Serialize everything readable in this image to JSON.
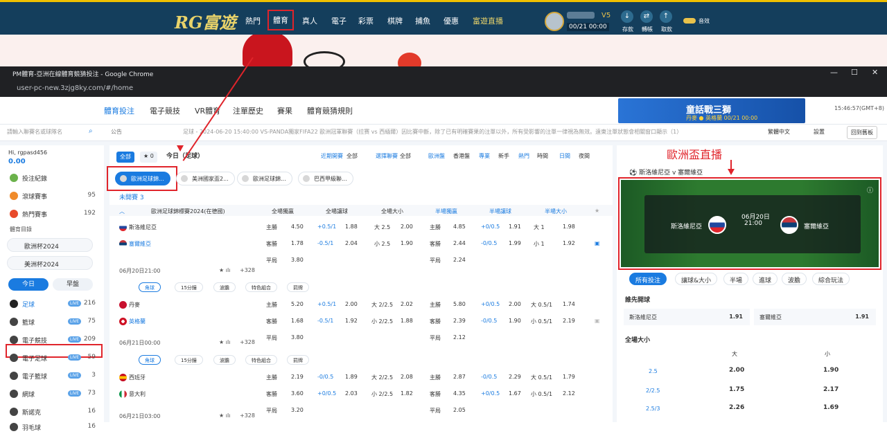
{
  "site": {
    "logo": "RG富遊",
    "nav": [
      "熱門",
      "體育",
      "真人",
      "電子",
      "彩票",
      "棋牌",
      "捕魚",
      "優惠",
      "富遊直播"
    ],
    "vip": "V5",
    "balance": "00/21 00:00",
    "top_icons": [
      "存款",
      "轉帳",
      "取款"
    ],
    "sound": "音效"
  },
  "chrome": {
    "title": "PM體育-亞洲在線體育競猜投注 - Google Chrome",
    "url": "user-pc-new.3zjg8ky.com/#/home",
    "min": "—",
    "max": "☐",
    "close": "✕"
  },
  "subnav": {
    "tabs": [
      "體育投注",
      "電子競技",
      "VR體育",
      "注單歷史",
      "賽果",
      "體育競猜規則"
    ],
    "promo_title": "童話戰三獅",
    "promo_sub": "丹麥 ● 英格蘭 00/21 00:00",
    "time": "15:46:57(GMT+8)"
  },
  "secondbar": {
    "search_placeholder": "請輸入聯賽名或球隊名",
    "notice_label": "公告",
    "marquee": "足球 - 2024-06-20 15:40:00 VS-PANDA獨家FIFA22 歐洲冠軍聯賽（拉赛 vs 西緬爾）因比賽中斷，除了已有明確賽果的注單以外，所有受影響的注單一律視為無效。遠東注單狀態會相關窗口顯示（1）",
    "lang": "繁體中文",
    "settings": "設置",
    "back": "回到舊板"
  },
  "sidebar": {
    "greet": "Hi, rgpasd456",
    "amount": "0.00",
    "rows": [
      {
        "label": "投注紀錄",
        "count": ""
      },
      {
        "label": "滾球賽事",
        "count": "95"
      },
      {
        "label": "熱門賽事",
        "count": "192"
      }
    ],
    "catalog": "體育目錄",
    "pills": [
      "歐洲杯2024",
      "美洲杯2024"
    ],
    "today": "今日",
    "early": "早盤",
    "sports": [
      {
        "label": "足球",
        "count": "216"
      },
      {
        "label": "籃球",
        "count": "75"
      },
      {
        "label": "電子競技",
        "count": "209"
      },
      {
        "label": "電子足球",
        "count": "59"
      },
      {
        "label": "電子籃球",
        "count": "3"
      },
      {
        "label": "網球",
        "count": "73"
      },
      {
        "label": "斯諾克",
        "count": "16"
      },
      {
        "label": "羽毛球",
        "count": "16"
      }
    ],
    "live": "LIVE"
  },
  "main": {
    "all": "全部",
    "fav": "0",
    "title": "今日（足球）",
    "filters": [
      "近期開賽",
      "全部",
      "選擇聯賽",
      "全部",
      "歐洲盤",
      "香港盤",
      "專業",
      "新手",
      "熱門",
      "時間",
      "日間",
      "夜間"
    ],
    "league_tabs": [
      "歐洲足球錦...",
      "美洲國家盃2...",
      "歐洲足球錦...",
      "巴西甲級聯..."
    ],
    "unstarted": "未開賽 3",
    "league_name": "歐洲足球錦標賽2024(在德國)",
    "headers": [
      "全場獨贏",
      "全場讓球",
      "全場大小",
      "半場獨贏",
      "半場讓球",
      "半場大小"
    ],
    "market_tabs": [
      "角球",
      "15分鐘",
      "波膽",
      "特色組合",
      "罰牌"
    ],
    "matches": [
      {
        "home": "斯洛維尼亞",
        "away": "塞爾維亞",
        "date": "06月20日21:00",
        "count": "+328",
        "rows": [
          [
            "主勝",
            "4.50",
            "+0.5/1",
            "1.88",
            "大 2.5",
            "2.00",
            "主勝",
            "4.85",
            "+0/0.5",
            "1.91",
            "大 1",
            "1.98"
          ],
          [
            "客勝",
            "1.78",
            "-0.5/1",
            "2.04",
            "小 2.5",
            "1.90",
            "客勝",
            "2.44",
            "-0/0.5",
            "1.99",
            "小 1",
            "1.92"
          ],
          [
            "平局",
            "3.80",
            "",
            "",
            "",
            "",
            "平局",
            "2.24",
            "",
            "",
            "",
            ""
          ]
        ]
      },
      {
        "home": "丹麥",
        "away": "英格蘭",
        "date": "06月21日00:00",
        "count": "+328",
        "rows": [
          [
            "主勝",
            "5.20",
            "+0.5/1",
            "2.00",
            "大 2/2.5",
            "2.02",
            "主勝",
            "5.80",
            "+0/0.5",
            "2.00",
            "大 0.5/1",
            "1.74"
          ],
          [
            "客勝",
            "1.68",
            "-0.5/1",
            "1.92",
            "小 2/2.5",
            "1.88",
            "客勝",
            "2.39",
            "-0/0.5",
            "1.90",
            "小 0.5/1",
            "2.19"
          ],
          [
            "平局",
            "3.80",
            "",
            "",
            "",
            "",
            "平局",
            "2.12",
            "",
            "",
            "",
            ""
          ]
        ]
      },
      {
        "home": "西班牙",
        "away": "意大利",
        "date": "06月21日03:00",
        "count": "+328",
        "rows": [
          [
            "主勝",
            "2.19",
            "-0/0.5",
            "1.89",
            "大 2/2.5",
            "2.08",
            "主勝",
            "2.87",
            "-0/0.5",
            "2.29",
            "大 0.5/1",
            "1.79"
          ],
          [
            "客勝",
            "3.60",
            "+0/0.5",
            "2.03",
            "小 2/2.5",
            "1.82",
            "客勝",
            "4.35",
            "+0/0.5",
            "1.67",
            "小 0.5/1",
            "2.12"
          ],
          [
            "平局",
            "3.20",
            "",
            "",
            "",
            "",
            "平局",
            "2.05",
            "",
            "",
            "",
            ""
          ]
        ]
      }
    ]
  },
  "right": {
    "title": "歐洲盃直播",
    "home": "斯洛維尼亞",
    "vs": "v",
    "away": "塞爾維亞",
    "stream_date": "06月20日",
    "stream_time": "21:00",
    "tabs": [
      "所有投注",
      "讓球&大小",
      "半場",
      "進球",
      "波膽",
      "綜合玩法"
    ],
    "sec1": "誰先開球",
    "sec1_home": "斯洛維尼亞",
    "sec1_home_odds": "1.91",
    "sec1_away": "塞爾維亞",
    "sec1_away_odds": "1.91",
    "sec2": "全場大小",
    "big": "大",
    "small": "小",
    "ou": [
      [
        "2.5",
        "2.00",
        "1.90"
      ],
      [
        "2/2.5",
        "1.75",
        "2.17"
      ],
      [
        "2.5/3",
        "2.26",
        "1.69"
      ]
    ]
  }
}
